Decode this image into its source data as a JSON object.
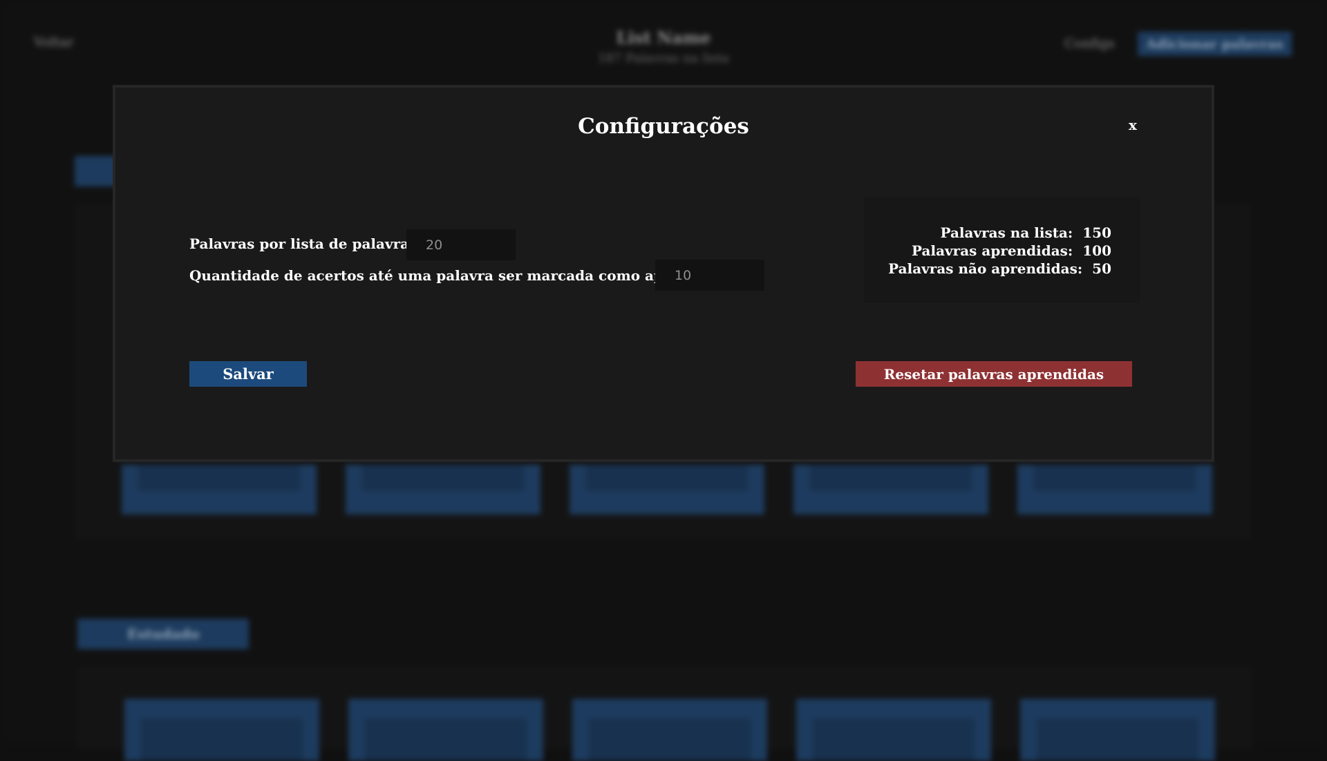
{
  "background": {
    "back_label": "Voltar",
    "list_title": "List Name",
    "list_subtitle": "187 Palavras na lista",
    "configs_label": "Configs",
    "add_words_label": "Adicionar palavras",
    "studied_section_label": "Estudado"
  },
  "modal": {
    "title": "Configurações",
    "close_label": "x",
    "fields": {
      "words_per_list": {
        "label": "Palavras por lista de palavras :",
        "value": "20"
      },
      "hits_until_learned": {
        "label": "Quantidade de acertos até uma palavra ser marcada como aprendida :",
        "value": "10"
      }
    },
    "stats": {
      "words_in_list_label": "Palavras na lista:",
      "words_in_list_value": "150",
      "learned_label": "Palavras aprendidas:",
      "learned_value": "100",
      "not_learned_label": "Palavras não aprendidas:",
      "not_learned_value": "50"
    },
    "save_label": "Salvar",
    "reset_label": "Resetar palavras aprendidas"
  },
  "colors": {
    "primary_button": "#1d4a7c",
    "danger_button": "#8e3133",
    "modal_background": "#1a1a1a",
    "page_background": "#101010"
  }
}
